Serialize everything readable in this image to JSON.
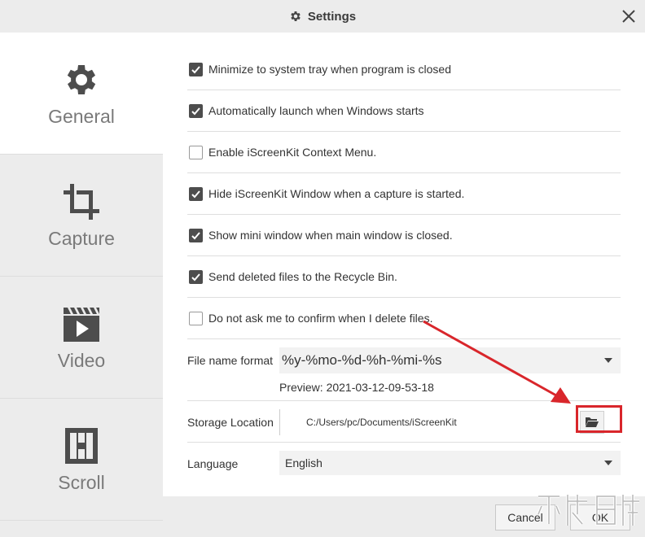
{
  "window": {
    "title": "Settings",
    "title_icon": "gear-icon",
    "close_icon": "close-icon"
  },
  "sidebar": {
    "items": [
      {
        "label": "General",
        "icon": "gear-icon",
        "active": true
      },
      {
        "label": "Capture",
        "icon": "crop-icon",
        "active": false
      },
      {
        "label": "Video",
        "icon": "video-clapper-icon",
        "active": false
      },
      {
        "label": "Scroll",
        "icon": "scroll-icon",
        "active": false
      }
    ]
  },
  "options": [
    {
      "label": "Minimize to system tray when program is closed",
      "checked": true
    },
    {
      "label": "Automatically launch when Windows starts",
      "checked": true
    },
    {
      "label": "Enable iScreenKit Context Menu.",
      "checked": false
    },
    {
      "label": "Hide iScreenKit Window when a capture is started.",
      "checked": true
    },
    {
      "label": "Show mini window when main window is closed.",
      "checked": true
    },
    {
      "label": "Send deleted files to the Recycle Bin.",
      "checked": true
    },
    {
      "label": "Do not ask me to confirm when I delete files.",
      "checked": false
    }
  ],
  "file_name_format": {
    "label": "File name format",
    "value": "%y-%mo-%d-%h-%mi-%s",
    "preview": "Preview: 2021-03-12-09-53-18"
  },
  "storage": {
    "label": "Storage Location",
    "path": "C:/Users/pc/Documents/iScreenKit",
    "button_icon": "folder-open-icon"
  },
  "language": {
    "label": "Language",
    "value": "English"
  },
  "footer": {
    "cancel_label": "Cancel",
    "ok_label": "OK"
  },
  "colors": {
    "sidebar_bg": "#ececec",
    "checkbox_on": "#4d4d4d",
    "annotation_red": "#d9262b"
  }
}
